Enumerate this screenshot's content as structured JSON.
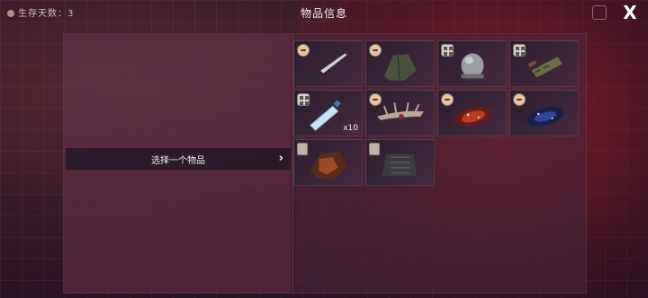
{
  "header": {
    "survival_label": "生存天数：3",
    "title": "物品信息",
    "close_label": "X"
  },
  "left_pane": {
    "select_label": "选择一个物品",
    "select_chevron": "›"
  },
  "items": [
    {
      "name": "knife",
      "badge": "face-icon",
      "quantity": ""
    },
    {
      "name": "green-jacket",
      "badge": "face-icon",
      "quantity": ""
    },
    {
      "name": "steel-helmet",
      "badge": "box-icon",
      "quantity": ""
    },
    {
      "name": "wrapped-tool",
      "badge": "box-icon",
      "quantity": ""
    },
    {
      "name": "water-bottle",
      "badge": "box-icon",
      "quantity": "x10"
    },
    {
      "name": "thorn-antlers",
      "badge": "face-icon",
      "quantity": ""
    },
    {
      "name": "red-nebula-crystal",
      "badge": "face-icon",
      "quantity": ""
    },
    {
      "name": "blue-nebula-crystal",
      "badge": "face-icon",
      "quantity": ""
    },
    {
      "name": "burnt-chunk",
      "badge": "armor-icon",
      "quantity": ""
    },
    {
      "name": "dark-armor",
      "badge": "armor-icon",
      "quantity": ""
    }
  ],
  "colors": {
    "accent_red": "#b8283a",
    "panel_bg": "#3a2538"
  }
}
